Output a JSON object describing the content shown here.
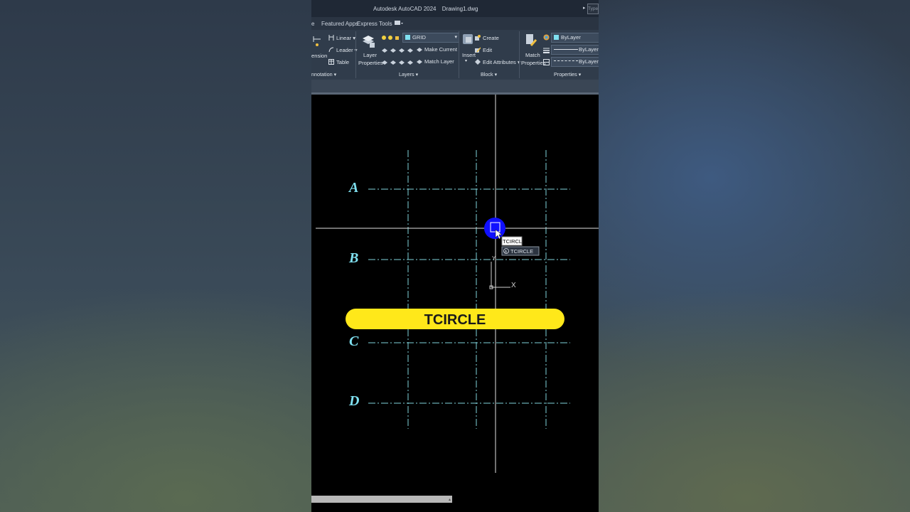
{
  "titlebar": {
    "app_name": "Autodesk AutoCAD 2024",
    "file_name": "Drawing1.dwg",
    "search_label": "Type"
  },
  "tabs": {
    "cut": "e",
    "featured": "Featured Apps",
    "express": "Express Tools"
  },
  "ribbon": {
    "annotation": {
      "dimension": "ension",
      "linear": "Linear",
      "leader": "Leader",
      "table": "Table",
      "panel": "nnotation"
    },
    "layers": {
      "layer_properties_1": "Layer",
      "layer_properties_2": "Properties",
      "current_layer": "GRID",
      "make_current": "Make Current",
      "match_layer": "Match Layer",
      "panel": "Layers"
    },
    "block": {
      "insert": "Insert",
      "create": "Create",
      "edit": "Edit",
      "edit_attributes": "Edit Attributes",
      "panel": "Block"
    },
    "properties": {
      "match_1": "Match",
      "match_2": "Properties",
      "color": "ByLayer",
      "lineweight": "ByLayer",
      "linetype": "ByLayer",
      "panel": "Properties"
    }
  },
  "canvas": {
    "grid_labels": [
      "A",
      "B",
      "C",
      "D"
    ],
    "command_input": "TCIRCLE",
    "command_suggestion": "TCIRCLE",
    "ucs_x": "X",
    "ucs_y": "Y",
    "banner": "TCIRCLE"
  },
  "colors": {
    "grid_line": "#7fd3dc",
    "label": "#7fe0f0",
    "banner_bg": "#ffe81a",
    "highlight": "#1010ff"
  }
}
